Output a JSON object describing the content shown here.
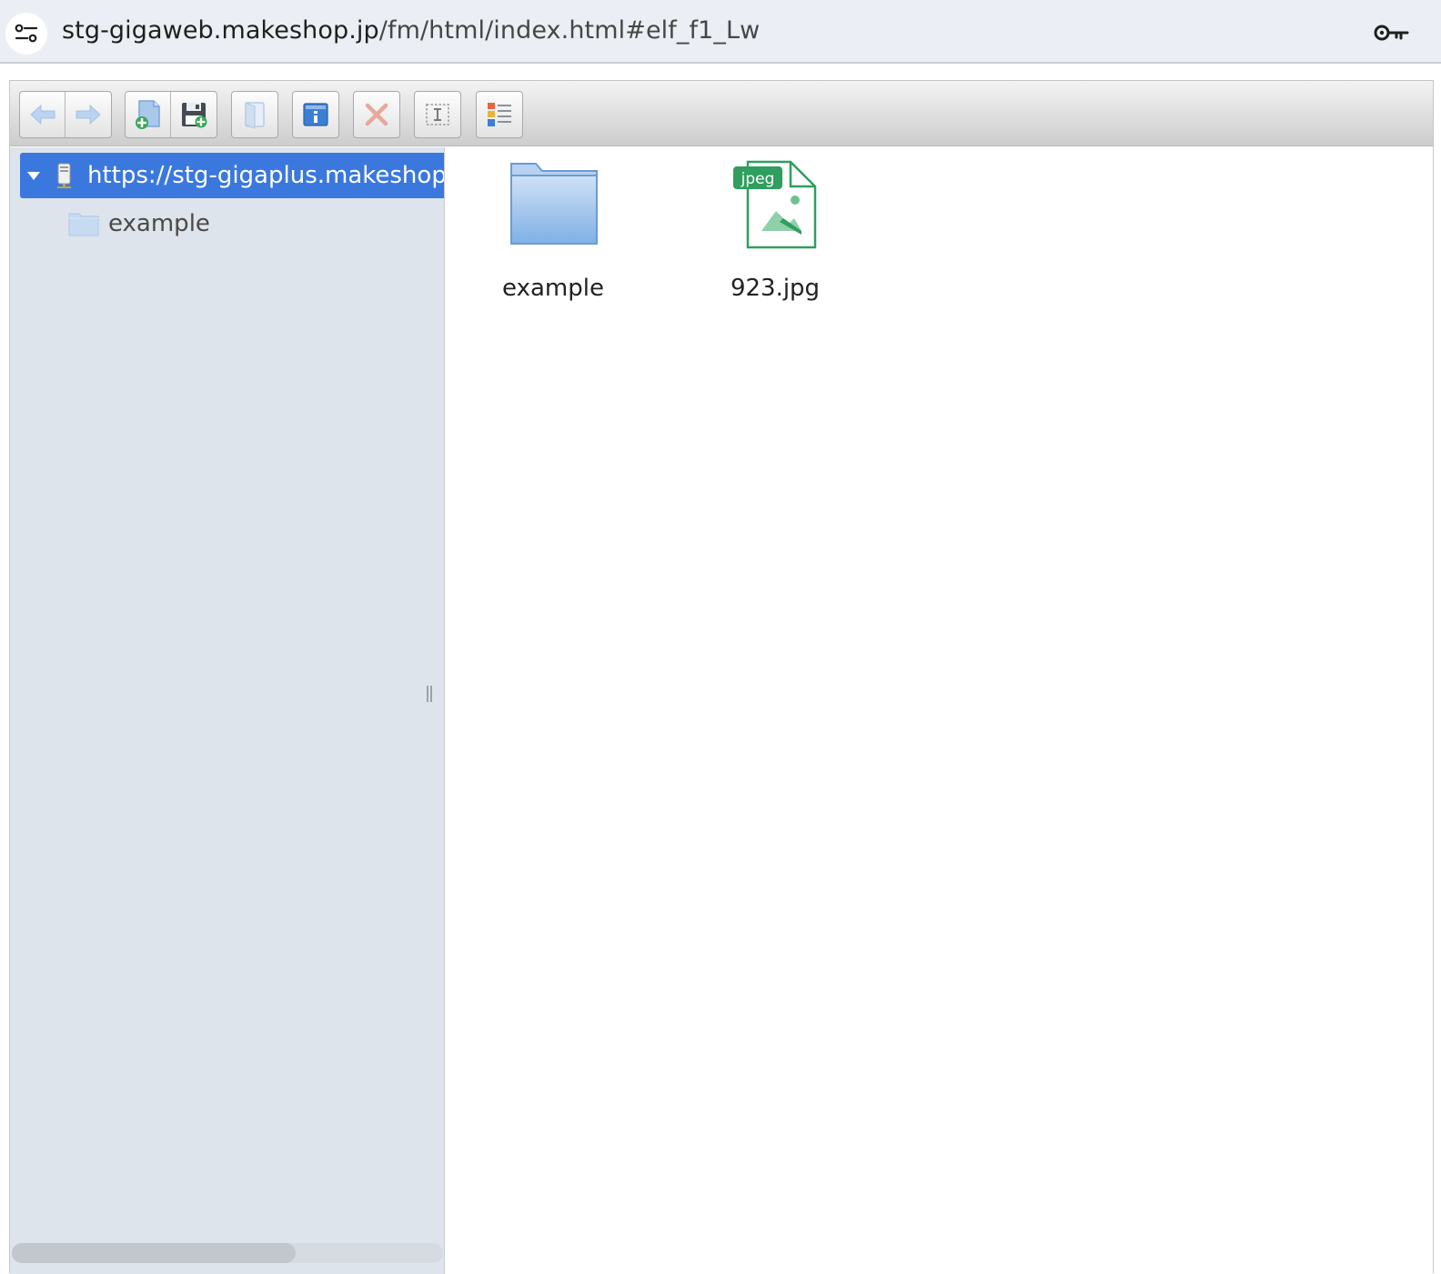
{
  "browser": {
    "url_host": "stg-gigaweb.makeshop.jp",
    "url_path": "/fm/html/index.html#elf_f1_Lw",
    "site_info_icon": "tune-icon",
    "password_icon": "key-icon"
  },
  "toolbar": {
    "buttons": [
      {
        "name": "back",
        "icon": "arrow-left-icon"
      },
      {
        "name": "forward",
        "icon": "arrow-right-icon"
      },
      {
        "name": "upload",
        "icon": "upload-icon"
      },
      {
        "name": "download",
        "icon": "save-icon"
      },
      {
        "name": "open",
        "icon": "open-icon"
      },
      {
        "name": "info",
        "icon": "info-icon"
      },
      {
        "name": "delete",
        "icon": "delete-icon"
      },
      {
        "name": "rename",
        "icon": "rename-icon"
      },
      {
        "name": "view",
        "icon": "list-view-icon"
      }
    ]
  },
  "tree": {
    "root_label": "https://stg-gigaplus.makeshop",
    "children": [
      {
        "label": "example"
      }
    ]
  },
  "files": [
    {
      "label": "example",
      "type": "folder"
    },
    {
      "label": "923.jpg",
      "type": "jpeg",
      "badge": "jpeg"
    }
  ],
  "colors": {
    "selection": "#3b78dd",
    "navbar_bg": "#dde4ec",
    "jpeg_green": "#2f9e5f"
  }
}
